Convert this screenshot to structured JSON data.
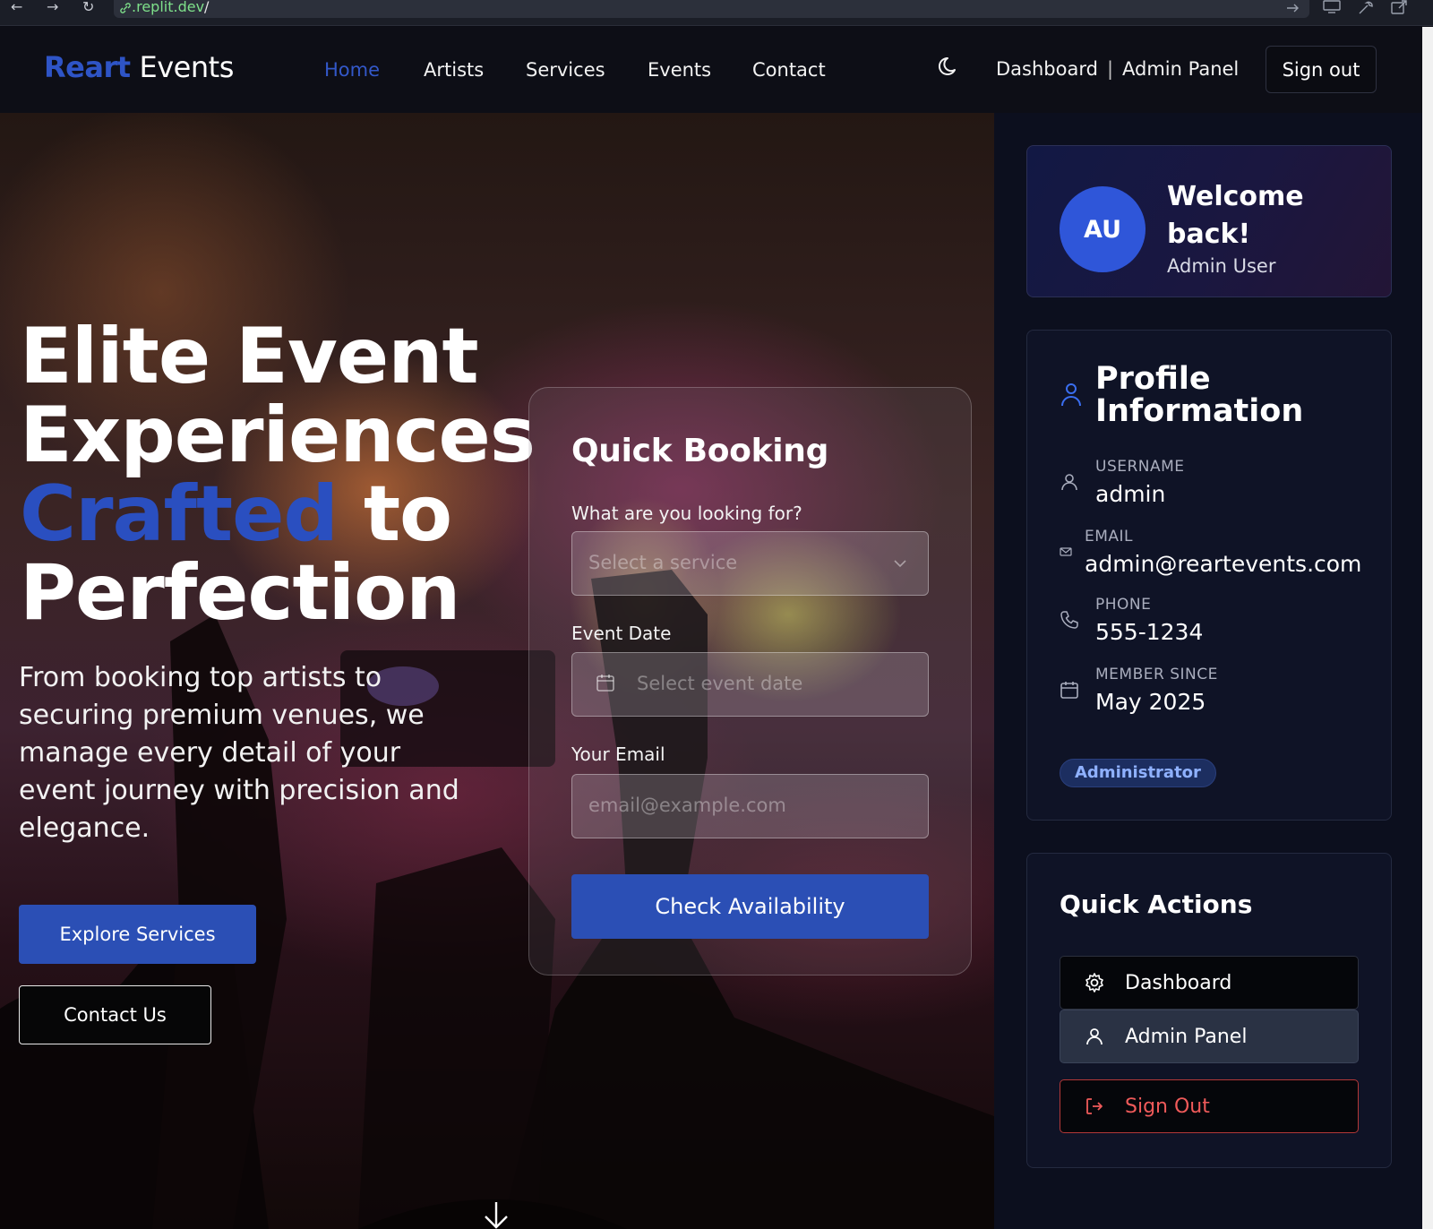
{
  "browser": {
    "url_host": ".replit.dev",
    "url_slash": "/",
    "back_glyph": "←",
    "forward_glyph": "→",
    "reload_glyph": "↻"
  },
  "nav": {
    "logo_brand": "Reart",
    "logo_rest": "Events",
    "links": [
      "Home",
      "Artists",
      "Services",
      "Events",
      "Contact"
    ],
    "active": "Home",
    "dashboard": "Dashboard",
    "separator": "|",
    "admin_panel": "Admin Panel",
    "sign_out": "Sign out",
    "theme_icon": "moon-icon"
  },
  "hero": {
    "title_line1": "Elite Event",
    "title_line2": "Experiences",
    "title_accent": "Crafted",
    "title_line3_rest": "to",
    "title_line4": "Perfection",
    "subtitle": "From booking top artists to securing premium venues, we manage every detail of your event journey with precision and elegance.",
    "primary_button": "Explore Services",
    "secondary_button": "Contact Us",
    "scroll_icon": "arrow-down-icon"
  },
  "booking": {
    "title": "Quick Booking",
    "service_label": "What are you looking for?",
    "service_placeholder": "Select a service",
    "date_label": "Event Date",
    "date_placeholder": "Select event date",
    "email_label": "Your Email",
    "email_placeholder": "email@example.com",
    "submit": "Check Availability"
  },
  "sidebar": {
    "welcome": {
      "initials": "AU",
      "heading": "Welcome back!",
      "name": "Admin User"
    },
    "profile": {
      "title": "Profile Information",
      "fields": [
        {
          "label": "USERNAME",
          "value": "admin",
          "icon": "user-icon"
        },
        {
          "label": "EMAIL",
          "value": "admin@reartevents.com",
          "icon": "mail-icon"
        },
        {
          "label": "PHONE",
          "value": "555-1234",
          "icon": "phone-icon"
        },
        {
          "label": "MEMBER SINCE",
          "value": "May 2025",
          "icon": "calendar-icon"
        }
      ],
      "role_badge": "Administrator"
    },
    "quick_actions": {
      "title": "Quick Actions",
      "dashboard": "Dashboard",
      "admin_panel": "Admin Panel",
      "sign_out": "Sign Out"
    }
  },
  "colors": {
    "accent": "#2b4fb5",
    "nav_active": "#3358c9",
    "danger": "#ef5a5a",
    "badge_text": "#8fb1ff"
  }
}
